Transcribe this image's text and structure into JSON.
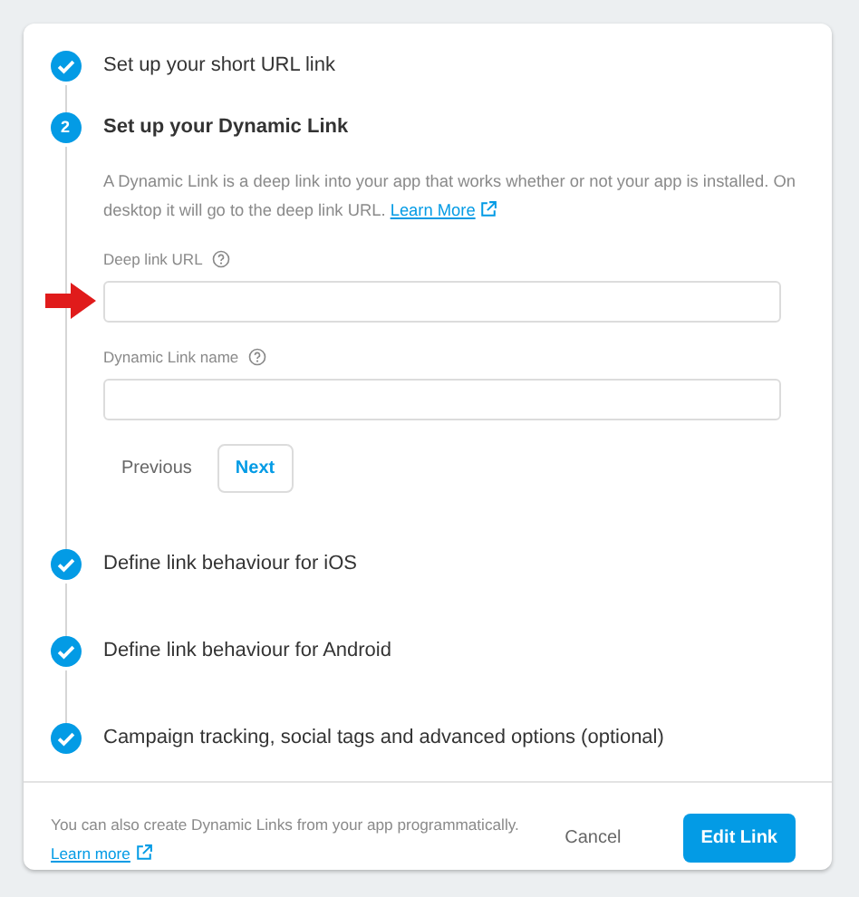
{
  "steps": [
    {
      "completed": true,
      "title": "Set up your short URL link"
    },
    {
      "completed": false,
      "number": "2",
      "title": "Set up your Dynamic Link",
      "description": "A Dynamic Link is a deep link into your app that works whether or not your app is installed. On desktop it will go to the deep link URL.",
      "link": "Learn More",
      "fields": [
        {
          "label": "Deep link URL",
          "annotated": true
        },
        {
          "label": "Dynamic Link name",
          "annotated": false
        }
      ],
      "buttons": [
        {
          "label": "Previous",
          "kind": "text"
        },
        {
          "label": "Next",
          "kind": "outline"
        }
      ]
    },
    {
      "completed": true,
      "title": "Define link behaviour for iOS"
    },
    {
      "completed": true,
      "title": "Define link behaviour for Android"
    },
    {
      "completed": true,
      "title": "Campaign tracking, social tags and advanced options (optional)"
    }
  ],
  "footer": {
    "text": "You can also create Dynamic Links from your app programmatically.",
    "link": "Learn more",
    "buttons": [
      {
        "label": "Cancel",
        "kind": "text"
      },
      {
        "label": "Edit Link",
        "kind": "primary"
      }
    ]
  }
}
